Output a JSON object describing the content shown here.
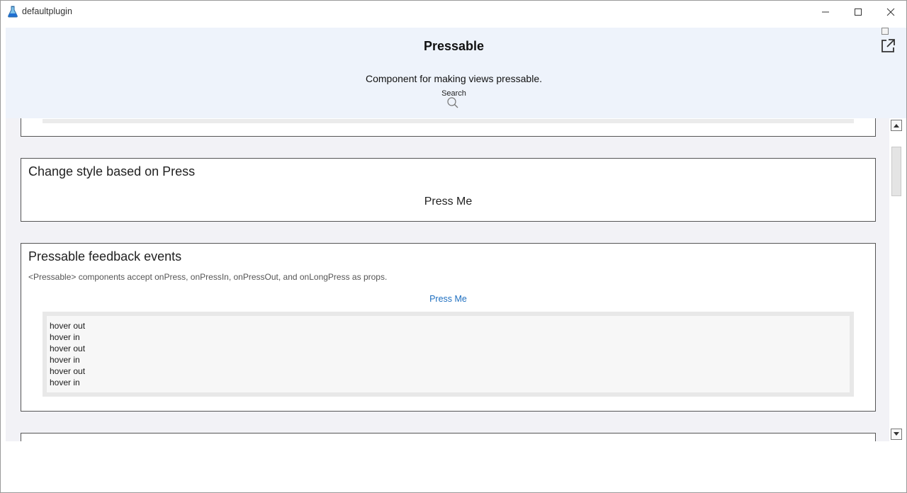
{
  "window": {
    "title": "defaultplugin"
  },
  "header": {
    "title": "Pressable",
    "description": "Component for making views pressable.",
    "search_label": "Search"
  },
  "cards": {
    "change_style": {
      "title": "Change style based on Press",
      "button_label": "Press Me"
    },
    "feedback_events": {
      "title": "Pressable feedback events",
      "description": "<Pressable> components accept onPress, onPressIn, onPressOut, and onLongPress as props.",
      "button_label": "Press Me",
      "log": [
        "hover out",
        "hover in",
        "hover out",
        "hover in",
        "hover out",
        "hover in"
      ]
    }
  },
  "colors": {
    "header_bg": "#eef3fb",
    "content_bg": "#f2f2f6",
    "link": "#1e6fc0"
  },
  "icons": {
    "app": "flask-icon",
    "search": "search-icon",
    "popout": "open-in-new-window-icon"
  }
}
